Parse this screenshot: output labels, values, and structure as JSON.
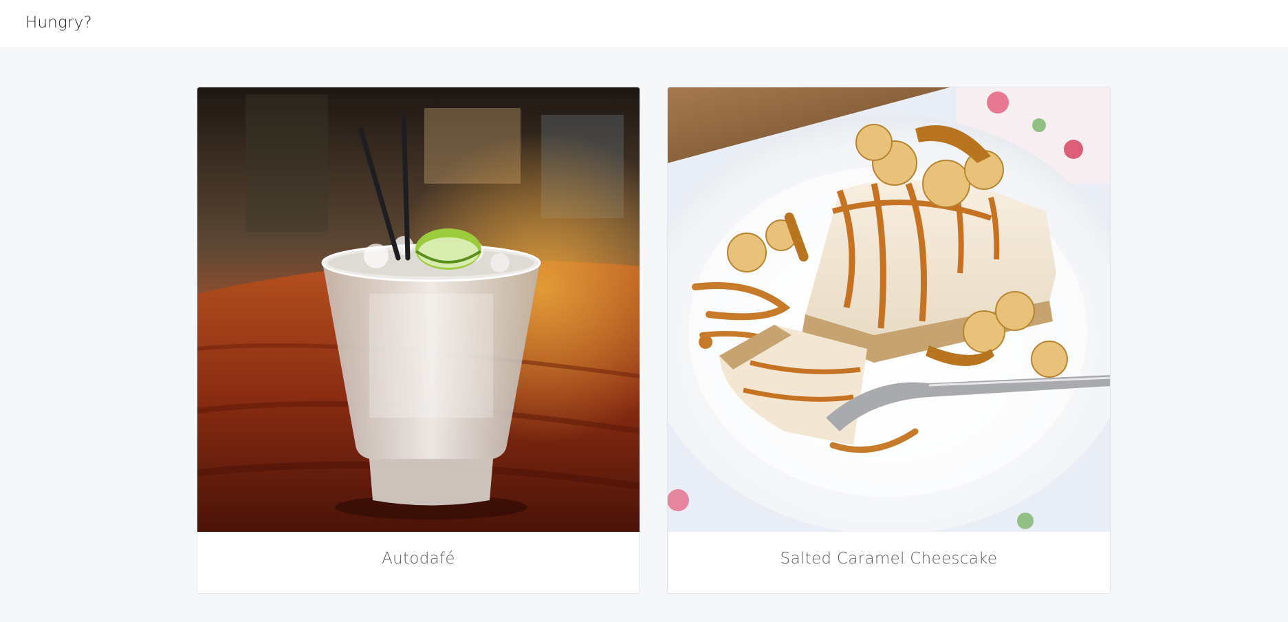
{
  "header": {
    "title": "Hungry?"
  },
  "cards": [
    {
      "name": "Autodafé",
      "photo_icon": "cocktail-photo"
    },
    {
      "name": "Salted Caramel Cheescake",
      "photo_icon": "cheesecake-photo"
    }
  ],
  "colors": {
    "page_background": "#f6f7f9",
    "card_background": "#ffffff",
    "caption_text": "#555a60",
    "header_text": "#222529"
  }
}
